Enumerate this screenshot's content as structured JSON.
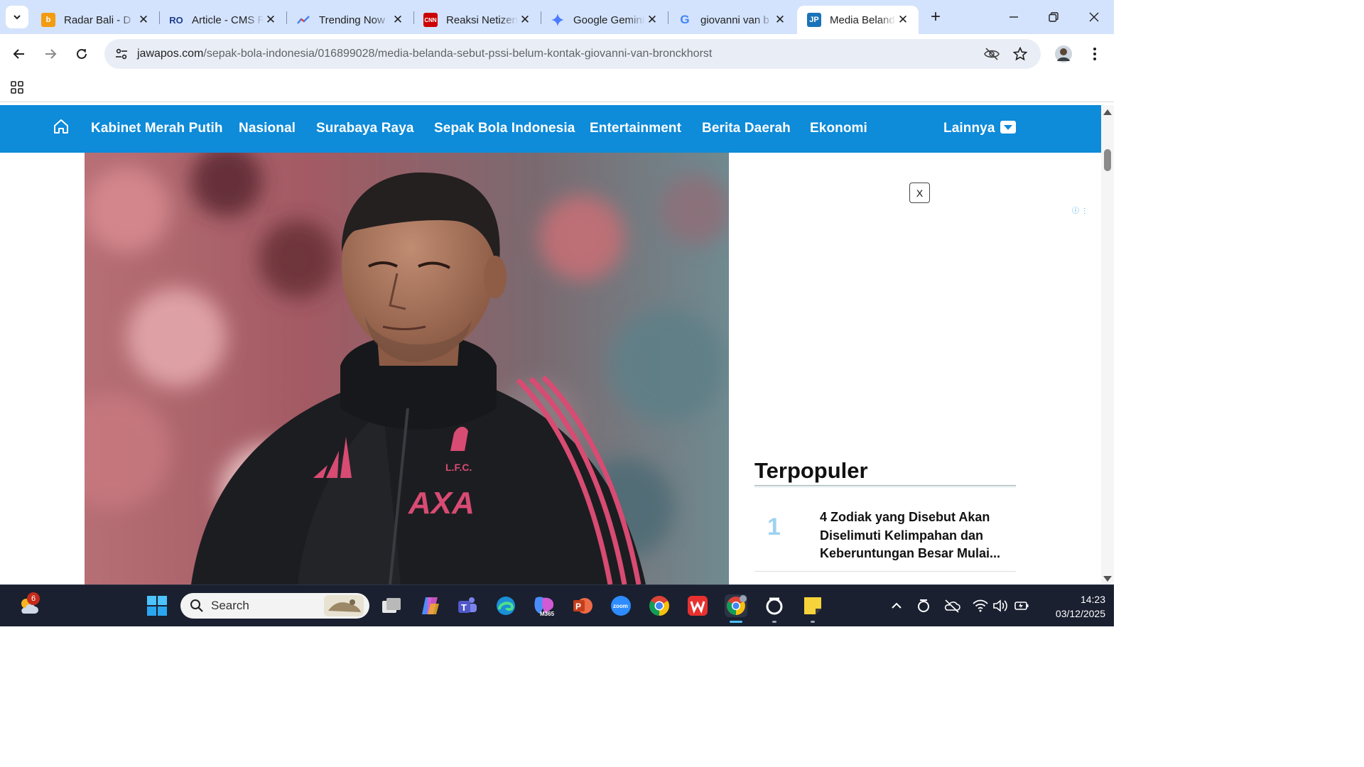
{
  "browser": {
    "tabs": [
      {
        "title": "Radar Bali - D",
        "favicon": "radar-bali-icon",
        "color": "#f39c12"
      },
      {
        "title": "Article - CMS R",
        "favicon": "ro-icon",
        "color": "#1f3b8f"
      },
      {
        "title": "Trending Now",
        "favicon": "trending-icon",
        "color": "#4285f4"
      },
      {
        "title": "Reaksi Netizen",
        "favicon": "cnn-icon",
        "color": "#cc0000"
      },
      {
        "title": "Google Gemini",
        "favicon": "gemini-icon",
        "color": "#4b7bff"
      },
      {
        "title": "giovanni van b",
        "favicon": "google-icon",
        "color": "#4285f4"
      },
      {
        "title": "Media Belanda",
        "favicon": "jp-icon",
        "color": "#1a73b8",
        "active": true
      }
    ],
    "url": {
      "host": "jawapos.com",
      "path": "/sepak-bola-indonesia/016899028/media-belanda-sebut-pssi-belum-kontak-giovanni-van-bronckhorst"
    }
  },
  "site": {
    "nav": [
      "Kabinet Merah Putih",
      "Nasional",
      "Surabaya Raya",
      "Sepak Bola Indonesia",
      "Entertainment",
      "Berita Daerah",
      "Ekonomi"
    ],
    "more_label": "Lainnya",
    "brand_color": "#0e8bd9"
  },
  "ad": {
    "close_label": "X",
    "choices_label": "ⓘ ⋮"
  },
  "popular": {
    "title": "Terpopuler",
    "items": [
      {
        "rank": "1",
        "text": "4 Zodiak yang Disebut Akan Diselimuti Kelimpahan dan Keberuntungan Besar Mulai..."
      }
    ]
  },
  "taskbar": {
    "weather_badge": "6",
    "search_label": "Search",
    "time": "14:23",
    "date": "03/12/2025"
  }
}
